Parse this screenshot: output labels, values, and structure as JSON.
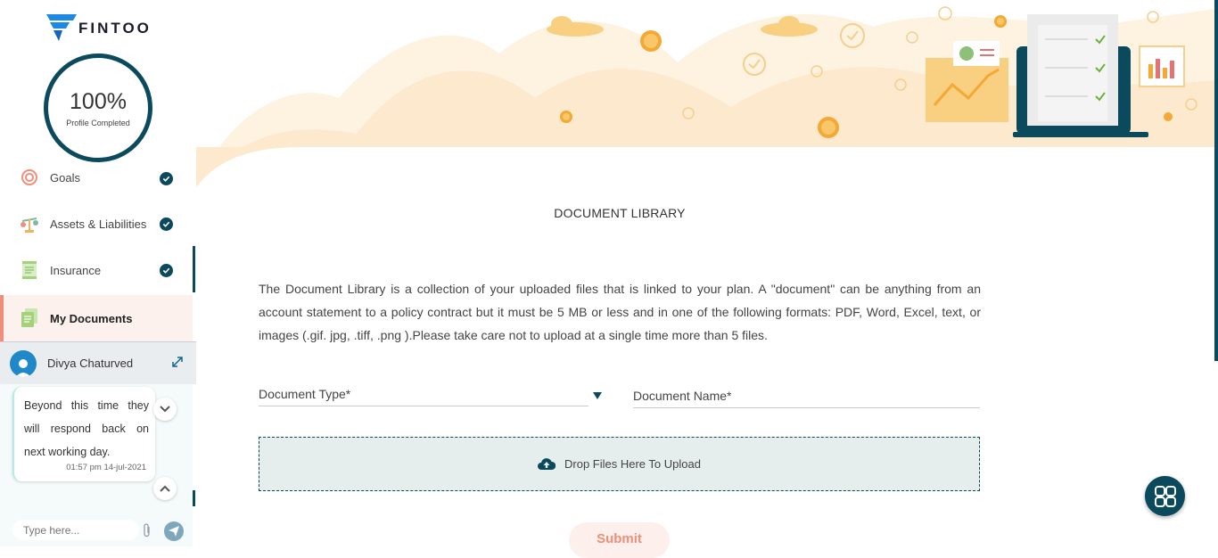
{
  "brand": {
    "name": "FINTOO"
  },
  "profile": {
    "percent": "100%",
    "label": "Profile Completed"
  },
  "nav": {
    "items": [
      {
        "label": "Goals",
        "icon": "target-icon",
        "completed": true
      },
      {
        "label": "Assets & Liabilities",
        "icon": "scale-icon",
        "completed": true
      },
      {
        "label": "Insurance",
        "icon": "scroll-icon",
        "completed": true
      },
      {
        "label": "My Documents",
        "icon": "documents-icon",
        "active": true
      }
    ]
  },
  "chat": {
    "name": "Divya Chaturved",
    "message": "Beyond this time they will respond back on next working day.",
    "time": "01:57 pm 14-jul-2021",
    "placeholder": "Type here..."
  },
  "main": {
    "title": "DOCUMENT LIBRARY",
    "description": "The Document Library is a collection of your uploaded files that is linked to your plan. A \"document\" can be anything from an account statement to a policy contract but it must be 5 MB or less and in one of the following formats: PDF, Word, Excel, text, or images (.gif. jpg, .tiff, .png ).Please take care not to upload at a single time more than 5 files.",
    "document_type_label": "Document Type*",
    "document_name_label": "Document Name*",
    "drop_label": "Drop Files Here To Upload",
    "submit_label": "Submit"
  },
  "colors": {
    "primary": "#0a4a5c",
    "accent": "#f08e7a",
    "banner": "#fde7c8"
  }
}
